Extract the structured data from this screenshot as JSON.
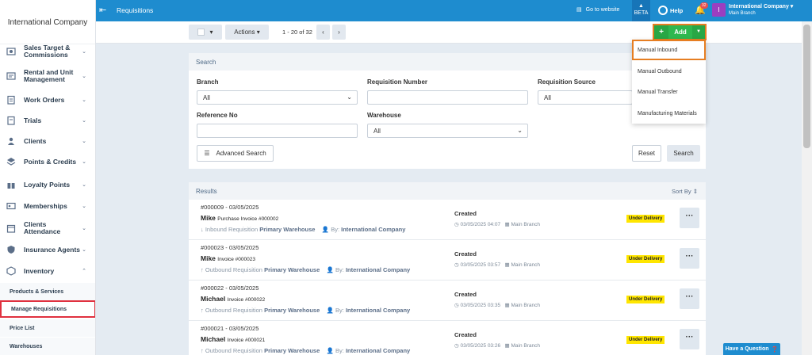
{
  "sidebar": {
    "company": "International Company",
    "items": [
      {
        "label": "Sales Target & Commissions",
        "icon": "target-icon"
      },
      {
        "label": "Rental and Unit Management",
        "icon": "rental-icon"
      },
      {
        "label": "Work Orders",
        "icon": "clipboard-icon"
      },
      {
        "label": "Trials",
        "icon": "trials-icon"
      },
      {
        "label": "Clients",
        "icon": "clients-icon"
      },
      {
        "label": "Points & Credits",
        "icon": "layers-icon"
      },
      {
        "label": "Loyalty Points",
        "icon": "gift-icon"
      },
      {
        "label": "Memberships",
        "icon": "membership-icon"
      },
      {
        "label": "Clients Attendance",
        "icon": "calendar-icon"
      },
      {
        "label": "Insurance Agents",
        "icon": "shield-icon"
      },
      {
        "label": "Inventory",
        "icon": "box-icon"
      }
    ],
    "sub_items": [
      "Products & Services",
      "Manage Requisitions",
      "Price List",
      "Warehouses"
    ]
  },
  "topbar": {
    "title": "Requisitions",
    "go_to_website": "Go to website",
    "beta": "BETA",
    "help": "Help",
    "notif_count": "32",
    "avatar_letter": "I",
    "user_name": "International Company",
    "branch": "Main Branch"
  },
  "toolbar": {
    "actions": "Actions",
    "pagination": "1 - 20 of 32",
    "add": "Add"
  },
  "add_menu": [
    "Manual Inbound",
    "Manual Outbound",
    "Manual Transfer",
    "Manufacturing Materials"
  ],
  "search": {
    "title": "Search",
    "branch_label": "Branch",
    "branch_value": "All",
    "req_number_label": "Requisition Number",
    "req_source_label": "Requisition Source",
    "req_source_value": "All",
    "ref_no_label": "Reference No",
    "warehouse_label": "Warehouse",
    "warehouse_value": "All",
    "advanced": "Advanced Search",
    "reset": "Reset",
    "search_btn": "Search"
  },
  "results": {
    "title": "Results",
    "sort_by": "Sort By",
    "rows": [
      {
        "code": "#000009 - 03/05/2025",
        "name": "Mike",
        "invoice": "Purchase Invoice #000002",
        "type": "Inbound Requisition",
        "warehouse": "Primary Warehouse",
        "by_label": "By:",
        "by": "International Company",
        "status": "Created",
        "date": "03/05/2025 04:07",
        "branch": "Main Branch",
        "badge": "Under Delivery"
      },
      {
        "code": "#000023 - 03/05/2025",
        "name": "Mike",
        "invoice": "Invoice #000023",
        "type": "Outbound Requisition",
        "warehouse": "Primary Warehouse",
        "by_label": "By:",
        "by": "International Company",
        "status": "Created",
        "date": "03/05/2025 03:57",
        "branch": "Main Branch",
        "badge": "Under Delivery"
      },
      {
        "code": "#000022 - 03/05/2025",
        "name": "Michael",
        "invoice": "Invoice #000022",
        "type": "Outbound Requisition",
        "warehouse": "Primary Warehouse",
        "by_label": "By:",
        "by": "International Company",
        "status": "Created",
        "date": "03/05/2025 03:35",
        "branch": "Main Branch",
        "badge": "Under Delivery"
      },
      {
        "code": "#000021 - 03/05/2025",
        "name": "Michael",
        "invoice": "Invoice #000021",
        "type": "Outbound Requisition",
        "warehouse": "Primary Warehouse",
        "by_label": "By:",
        "by": "International Company",
        "status": "Created",
        "date": "03/05/2025 03:26",
        "branch": "Main Branch",
        "badge": "Under Delivery"
      }
    ]
  },
  "ask": "Have a Question",
  "colors": {
    "topbar": "#1e8ccf",
    "add": "#2eb84f",
    "highlight": "#e67e22",
    "active_sub": "#e0313f",
    "badge": "#ffe600"
  }
}
